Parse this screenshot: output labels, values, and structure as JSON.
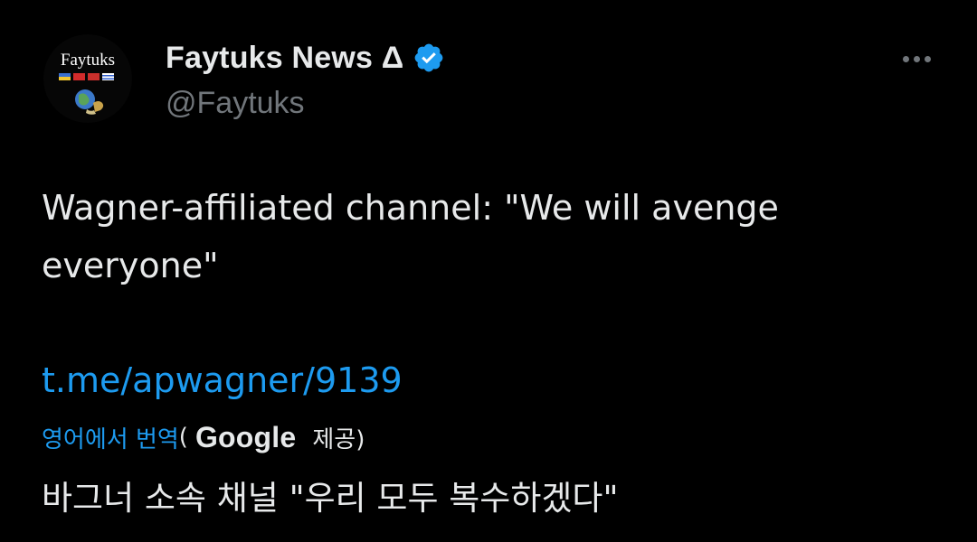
{
  "author": {
    "name": "Faytuks News Δ",
    "handle": "@Faytuks",
    "avatar_text": "Faytuks",
    "verified": true
  },
  "icons": {
    "verified": "verified-badge-icon",
    "more": "more-horizontal-icon"
  },
  "tweet": {
    "text": "Wagner-affiliated channel: \"We will avenge everyone\"",
    "link": "t.me/apwagner/9139"
  },
  "translation": {
    "translate_label": "영어에서 번역",
    "paren_open": "(",
    "provider": "Google",
    "provided_by": "제공)",
    "translated_text": "바그너 소속 채널 \"우리 모두 복수하겠다\""
  },
  "colors": {
    "background": "#000000",
    "text": "#e7e9ea",
    "secondary": "#71767b",
    "accent": "#1d9bf0"
  }
}
